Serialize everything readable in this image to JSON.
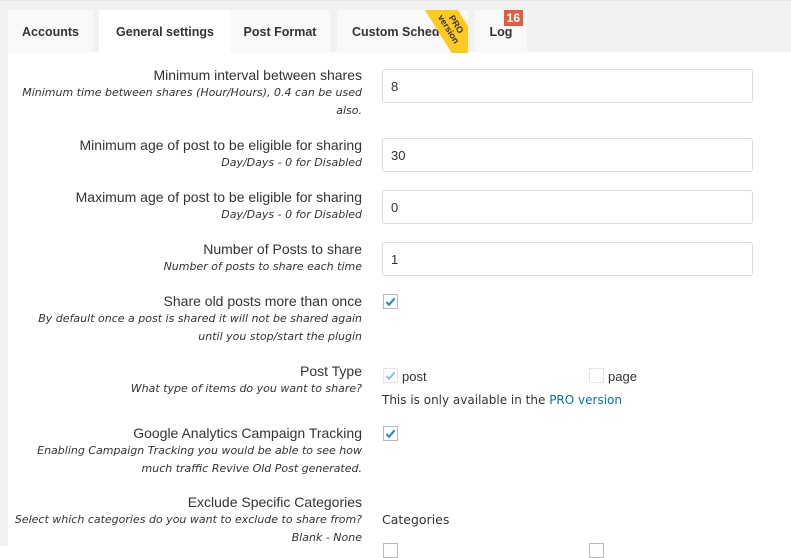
{
  "tabs": [
    {
      "label": "Accounts",
      "active": false
    },
    {
      "label": "General settings",
      "active": true
    },
    {
      "label": "Post Format",
      "active": false
    },
    {
      "label": "Custom Schedule",
      "active": false,
      "ribbon_line1": "PRO",
      "ribbon_line2": "version"
    },
    {
      "label": "Log",
      "active": false,
      "badge": "16"
    }
  ],
  "settings": {
    "min_interval": {
      "label": "Minimum interval between shares",
      "desc_line1": "Minimum time between shares (Hour/Hours), 0.4 can be used",
      "desc_line2": "also.",
      "value": "8"
    },
    "min_age": {
      "label": "Minimum age of post to be eligible for sharing",
      "desc": "Day/Days - 0 for Disabled",
      "value": "30"
    },
    "max_age": {
      "label": "Maximum age of post to be eligible for sharing",
      "desc": "Day/Days - 0 for Disabled",
      "value": "0"
    },
    "num_posts": {
      "label": "Number of Posts to share",
      "desc": "Number of posts to share each time",
      "value": "1"
    },
    "share_more": {
      "label": "Share old posts more than once",
      "desc_line1": "By default once a post is shared it will not be shared again",
      "desc_line2": "until you stop/start the plugin",
      "checked": true
    },
    "post_type": {
      "label": "Post Type",
      "desc": "What type of items do you want to share?",
      "options": [
        {
          "label": "post",
          "checked": true,
          "disabled": true
        },
        {
          "label": "page",
          "checked": false,
          "disabled": true
        }
      ],
      "note_prefix": "This is only available in the ",
      "note_link": "PRO version"
    },
    "ga_tracking": {
      "label": "Google Analytics Campaign Tracking",
      "desc_line1": "Enabling Campaign Tracking you would be able to see how",
      "desc_line2": "much traffic Revive Old Post generated.",
      "checked": true
    },
    "exclude_categories": {
      "label": "Exclude Specific Categories",
      "desc_line1": "Select which categories do you want to exclude to share from?",
      "desc_line2": "Blank - None",
      "heading": "Categories"
    }
  },
  "colors": {
    "accent": "#0073aa",
    "badge": "#e25d3f",
    "ribbon": "#ffc920"
  }
}
